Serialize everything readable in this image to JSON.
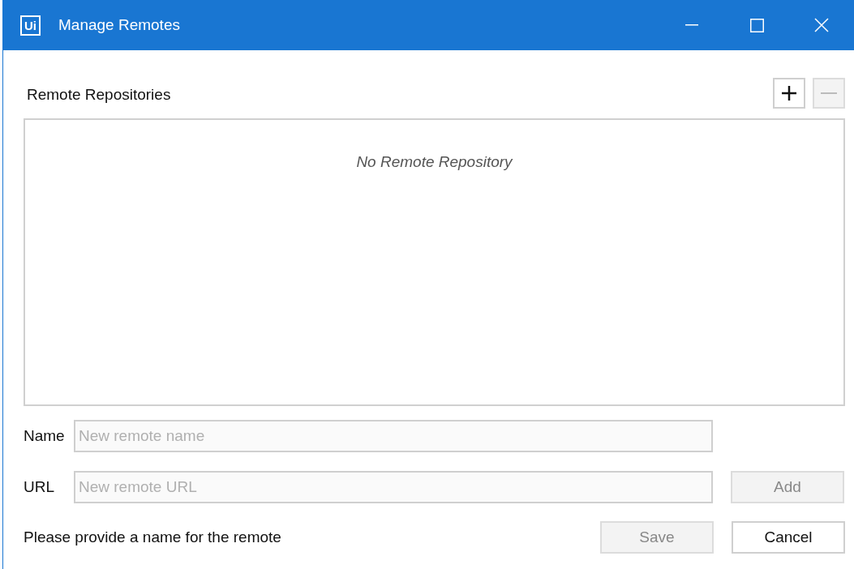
{
  "window": {
    "logo": "Ui",
    "title": "Manage Remotes"
  },
  "repositories": {
    "label": "Remote Repositories",
    "add_disabled": false,
    "remove_disabled": true,
    "empty_text": "No Remote Repository"
  },
  "fields": [
    {
      "label": "Name",
      "placeholder": "New remote name"
    },
    {
      "label": "URL",
      "placeholder": "New remote URL"
    }
  ],
  "add_button": {
    "label": "Add",
    "disabled": true
  },
  "message": "Please provide a name for the remote",
  "buttons": [
    {
      "label": "Save",
      "disabled": true
    },
    {
      "label": "Cancel",
      "disabled": false
    }
  ]
}
